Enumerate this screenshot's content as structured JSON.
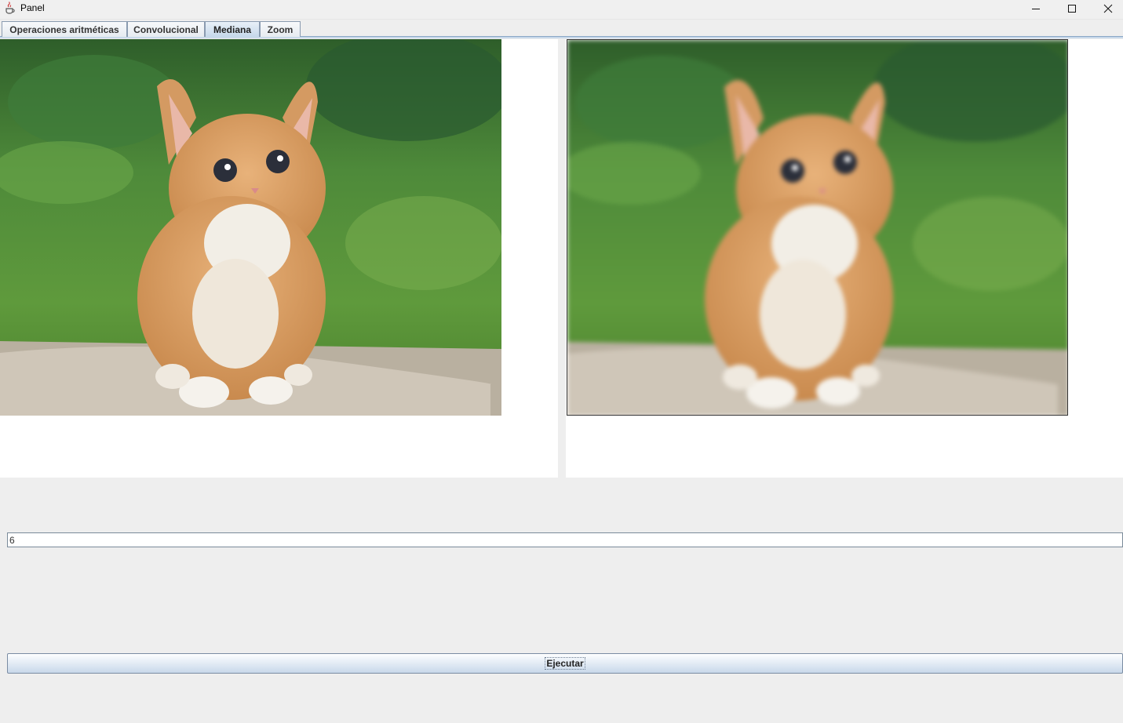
{
  "window": {
    "title": "Panel",
    "icon": "java-cup-icon"
  },
  "tabs": [
    {
      "label": "Operaciones aritméticas",
      "selected": false
    },
    {
      "label": "Convolucional",
      "selected": false
    },
    {
      "label": "Mediana",
      "selected": true
    },
    {
      "label": "Zoom",
      "selected": false
    }
  ],
  "images": {
    "original": "kitten photo",
    "filtered": "kitten photo (median filtered)"
  },
  "input": {
    "value": "6"
  },
  "execute_button": {
    "label": "Ejecutar"
  },
  "colors": {
    "window_bg": "#eeeeee",
    "tab_selected": "#c6d8ea",
    "button_gradient_bottom": "#c8d8ea"
  }
}
